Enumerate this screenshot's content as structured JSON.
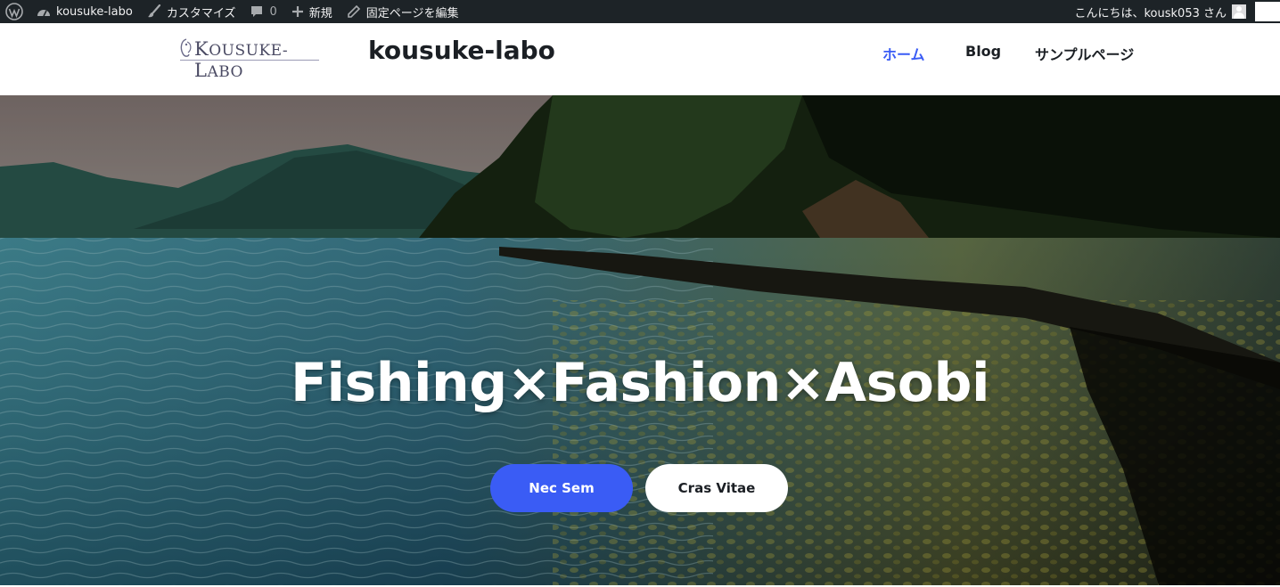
{
  "admin_bar": {
    "site_name": "kousuke-labo",
    "customize_label": "カスタマイズ",
    "comments_count": "0",
    "new_label": "新規",
    "edit_label": "固定ページを編集",
    "greeting": "こんにちは、kousk053 さん"
  },
  "header": {
    "logo_text_first": "K",
    "logo_text_rest": "OUSUKE-",
    "logo_text_first2": "L",
    "logo_text_rest2": "ABO",
    "site_title": "kousuke-labo",
    "nav": [
      {
        "label": "ホーム",
        "active": true
      },
      {
        "label": "Blog",
        "active": false
      },
      {
        "label": "サンプルページ",
        "active": false
      }
    ]
  },
  "hero": {
    "title": "Fishing×Fashion×Asobi",
    "primary_button": "Nec Sem",
    "secondary_button": "Cras Vitae"
  },
  "colors": {
    "admin_bar_bg": "#1d2327",
    "accent": "#3a5cf5",
    "text_dark": "#1b1f24"
  }
}
